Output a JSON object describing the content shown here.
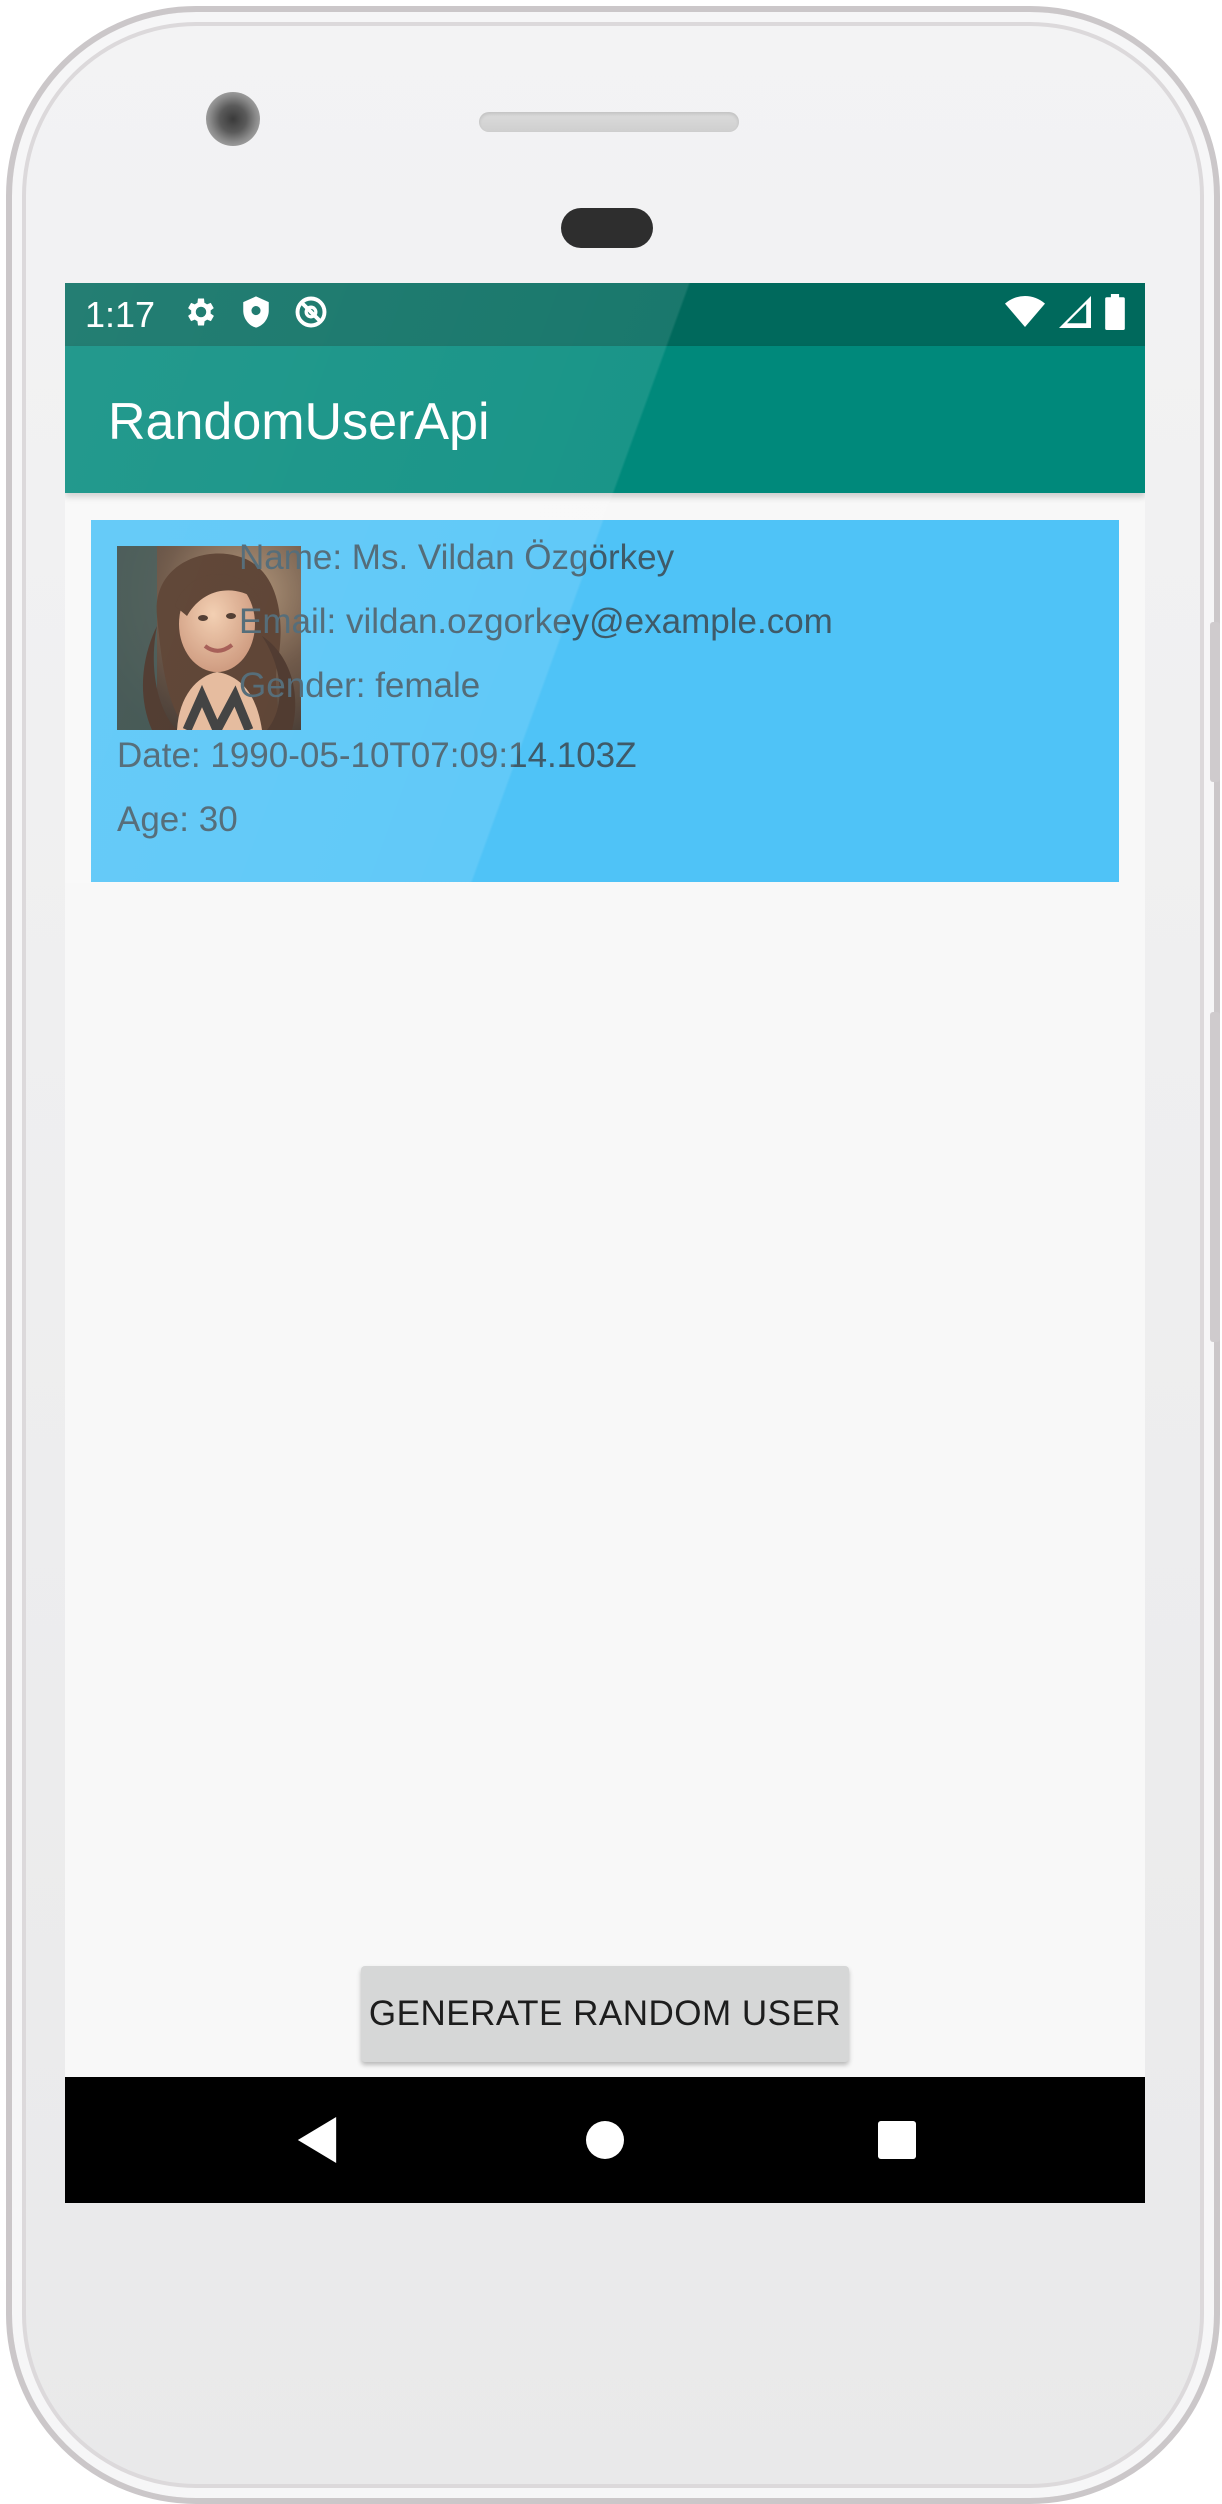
{
  "status_bar": {
    "time": "1:17",
    "icons_left": [
      "gear-icon",
      "shield-icon",
      "do-not-disturb-icon"
    ],
    "icons_right": [
      "wifi-icon",
      "cell-signal-icon",
      "battery-icon"
    ],
    "background": "#00695c"
  },
  "app_bar": {
    "title": "RandomUserApi",
    "background": "#00897b"
  },
  "user_card": {
    "background": "#4fc3f7",
    "name": "Name: Ms. Vildan Özgörkey",
    "email": "Email: vildan.ozgorkey@example.com",
    "gender": "Gender: female",
    "date": "Date: 1990-05-10T07:09:14.103Z",
    "age": "Age: 30",
    "avatar_icon": "user-photo"
  },
  "generate_button": {
    "label": "GENERATE RANDOM USER"
  },
  "nav_bar": {
    "icons": [
      "back-icon",
      "home-icon",
      "recents-icon"
    ]
  }
}
